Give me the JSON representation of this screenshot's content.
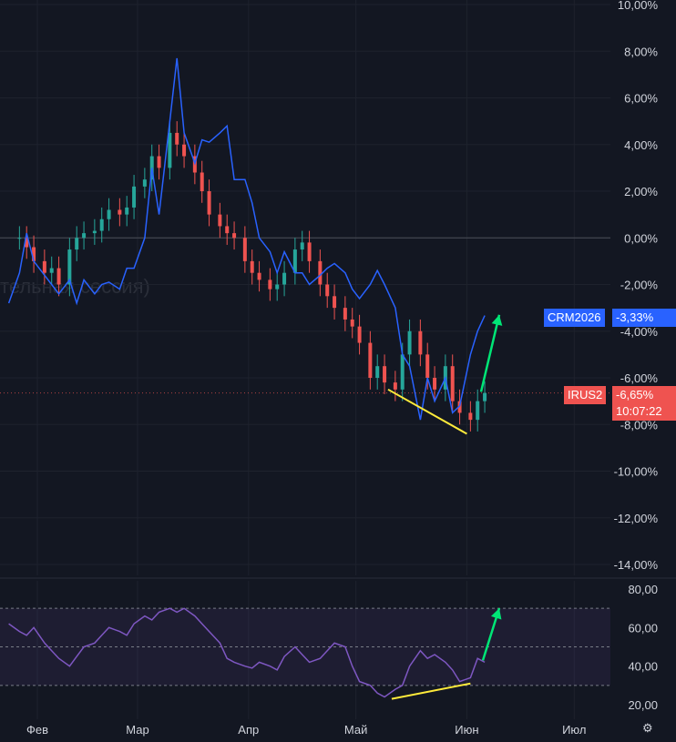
{
  "watermark": "тельная сессия)",
  "main_chart": {
    "y_ticks": [
      "10,00%",
      "8,00%",
      "6,00%",
      "4,00%",
      "2,00%",
      "0,00%",
      "-2,00%",
      "-4,00%",
      "-6,00%",
      "-8,00%",
      "-10,00%",
      "-12,00%",
      "-14,00%"
    ]
  },
  "rsi_chart": {
    "y_ticks": [
      "80,00",
      "60,00",
      "40,00",
      "20,00"
    ]
  },
  "x_axis": [
    "Фев",
    "Мар",
    "Апр",
    "Май",
    "Июн",
    "Июл"
  ],
  "badges": {
    "crm_name": "CRM2026",
    "crm_value": "-3,33%",
    "irus_name": "IRUS2",
    "irus_value": "-6,65%",
    "irus_time": "10:07:22"
  },
  "colors": {
    "background": "#131722",
    "candle_up": "#26a69a",
    "candle_down": "#ef5350",
    "crm_line": "#2962ff",
    "rsi_line": "#7e57c2",
    "trendline": "#ffeb3b",
    "arrow": "#00e676"
  },
  "chart_data": [
    {
      "type": "line",
      "series": [
        {
          "name": "CRM2026",
          "x": [
            "01-24",
            "01-27",
            "01-29",
            "01-31",
            "02-03",
            "02-05",
            "02-07",
            "02-10",
            "02-12",
            "02-14",
            "02-17",
            "02-19",
            "02-21",
            "02-24",
            "02-26",
            "02-28",
            "03-03",
            "03-05",
            "03-07",
            "03-10",
            "03-12",
            "03-14",
            "03-17",
            "03-19",
            "03-21",
            "03-24",
            "03-26",
            "03-28",
            "03-31",
            "04-02",
            "04-04",
            "04-07",
            "04-09",
            "04-11",
            "04-14",
            "04-16",
            "04-18",
            "04-21",
            "04-23",
            "04-25",
            "04-28",
            "04-30",
            "05-02",
            "05-05",
            "05-07",
            "05-09",
            "05-12",
            "05-14",
            "05-16",
            "05-19",
            "05-21",
            "05-23",
            "05-26",
            "05-28",
            "05-30",
            "06-02",
            "06-04",
            "06-06"
          ],
          "values": [
            -2.8,
            -1.5,
            0.2,
            -1.0,
            -1.6,
            -2.0,
            -2.4,
            -1.8,
            -2.8,
            -1.8,
            -2.4,
            -2.0,
            -1.9,
            -2.2,
            -1.3,
            -1.3,
            0.0,
            3.0,
            1.0,
            5.0,
            7.7,
            4.5,
            3.2,
            4.2,
            4.1,
            4.5,
            4.8,
            2.5,
            2.5,
            1.5,
            0.0,
            -0.6,
            -1.5,
            -0.6,
            -1.5,
            -1.5,
            -2.0,
            -1.6,
            -1.3,
            -1.1,
            -1.5,
            -2.2,
            -2.6,
            -2.0,
            -1.4,
            -2.0,
            -3.0,
            -5.0,
            -5.5,
            -7.8,
            -6.0,
            -7.0,
            -6.0,
            -7.5,
            -7.2,
            -5.0,
            -4.0,
            -3.33
          ]
        },
        {
          "name": "IRUS2",
          "x": [
            "01-24",
            "01-27",
            "01-29",
            "01-31",
            "02-03",
            "02-05",
            "02-07",
            "02-10",
            "02-12",
            "02-14",
            "02-17",
            "02-19",
            "02-21",
            "02-24",
            "02-26",
            "02-28",
            "03-03",
            "03-05",
            "03-07",
            "03-10",
            "03-12",
            "03-14",
            "03-17",
            "03-19",
            "03-21",
            "03-24",
            "03-26",
            "03-28",
            "03-31",
            "04-02",
            "04-04",
            "04-07",
            "04-09",
            "04-11",
            "04-14",
            "04-16",
            "04-18",
            "04-21",
            "04-23",
            "04-25",
            "04-28",
            "04-30",
            "05-02",
            "05-05",
            "05-07",
            "05-09",
            "05-12",
            "05-14",
            "05-16",
            "05-19",
            "05-21",
            "05-23",
            "05-26",
            "05-28",
            "05-30",
            "06-02",
            "06-04",
            "06-06"
          ],
          "values": [
            0.0,
            0.0,
            -0.4,
            -1.0,
            -1.5,
            -1.3,
            -2.0,
            -0.5,
            0.0,
            0.2,
            0.3,
            0.8,
            1.2,
            1.0,
            1.3,
            2.2,
            2.5,
            3.5,
            3.0,
            4.5,
            4.0,
            3.5,
            2.8,
            2.0,
            1.0,
            0.5,
            0.2,
            0.0,
            -1.0,
            -1.5,
            -1.8,
            -2.2,
            -2.0,
            -1.5,
            -0.5,
            -0.2,
            -1.0,
            -2.0,
            -2.5,
            -3.0,
            -3.5,
            -3.8,
            -4.5,
            -6.0,
            -5.5,
            -6.2,
            -6.5,
            -5.0,
            -4.0,
            -5.0,
            -6.0,
            -6.5,
            -5.5,
            -7.0,
            -7.5,
            -7.8,
            -7.0,
            -6.65
          ]
        }
      ],
      "y_range": [
        -14,
        10
      ],
      "y_unit": "%"
    },
    {
      "type": "line",
      "series": [
        {
          "x": [
            "01-24",
            "01-27",
            "01-29",
            "01-31",
            "02-03",
            "02-05",
            "02-07",
            "02-10",
            "02-12",
            "02-14",
            "02-17",
            "02-19",
            "02-21",
            "02-24",
            "02-26",
            "02-28",
            "03-03",
            "03-05",
            "03-07",
            "03-10",
            "03-12",
            "03-14",
            "03-17",
            "03-19",
            "03-21",
            "03-24",
            "03-26",
            "03-28",
            "03-31",
            "04-02",
            "04-04",
            "04-07",
            "04-09",
            "04-11",
            "04-14",
            "04-16",
            "04-18",
            "04-21",
            "04-23",
            "04-25",
            "04-28",
            "04-30",
            "05-02",
            "05-05",
            "05-07",
            "05-09",
            "05-12",
            "05-14",
            "05-16",
            "05-19",
            "05-21",
            "05-23",
            "05-26",
            "05-28",
            "05-30",
            "06-02",
            "06-04",
            "06-06"
          ],
          "values": [
            62,
            58,
            56,
            60,
            52,
            48,
            44,
            40,
            45,
            50,
            52,
            56,
            60,
            58,
            56,
            62,
            66,
            64,
            68,
            70,
            68,
            70,
            66,
            62,
            58,
            52,
            44,
            42,
            40,
            39,
            42,
            40,
            38,
            45,
            50,
            46,
            42,
            44,
            48,
            52,
            50,
            40,
            32,
            30,
            26,
            24,
            28,
            30,
            40,
            48,
            44,
            46,
            42,
            38,
            32,
            34,
            44,
            42
          ]
        }
      ],
      "y_range": [
        15,
        85
      ],
      "guides": [
        30,
        50,
        70
      ]
    }
  ]
}
